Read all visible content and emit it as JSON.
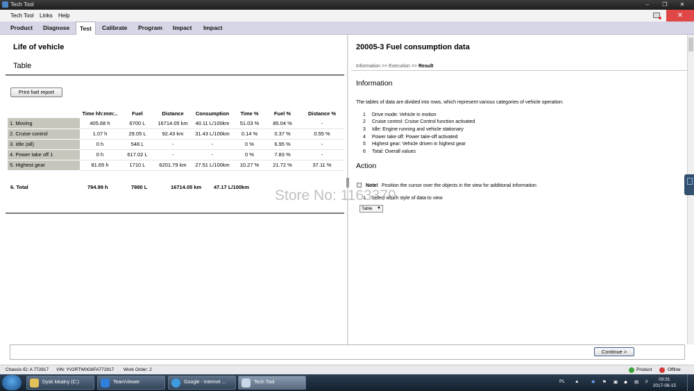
{
  "window": {
    "title": "Tech Tool"
  },
  "menu": {
    "items": [
      "Tech Tool",
      "Links",
      "Help"
    ]
  },
  "nav": {
    "tabs": [
      "Product",
      "Diagnose",
      "Test",
      "Calibrate",
      "Program",
      "Impact",
      "Impact"
    ],
    "active": "Test"
  },
  "left": {
    "title": "Life of vehicle",
    "subtitle": "Table",
    "print_button": "Print fuel report",
    "columns": [
      "Time hh:mm:..",
      "Fuel",
      "Distance",
      "Consumption",
      "Time %",
      "Fuel %",
      "Distance %"
    ],
    "rows": [
      {
        "label": "1. Moving",
        "cells": [
          "405.68 h",
          "6700 L",
          "16714.05 km",
          "40.11 L/100km",
          "51.03 %",
          "85.04 %",
          "-"
        ]
      },
      {
        "label": "2. Cruise control",
        "cells": [
          "1.07 h",
          "29.05 L",
          "92.43 km",
          "31.43 L/100km",
          "0.14 %",
          "0.37 %",
          "0.55 %"
        ]
      },
      {
        "label": "3. Idle (all)",
        "cells": [
          "0 h",
          "548 L",
          "-",
          "-",
          "0 %",
          "6.95 %",
          "-"
        ]
      },
      {
        "label": "4. Power take off 1",
        "cells": [
          "0 h",
          "617.02 L",
          "-",
          "-",
          "0 %",
          "7.83 %",
          "-"
        ]
      },
      {
        "label": "5. Highest gear",
        "cells": [
          "81.65 h",
          "1710 L",
          "6201.79 km",
          "27.51 L/100km",
          "10.27 %",
          "21.72 %",
          "37.11 %"
        ]
      }
    ],
    "total": {
      "label": "6. Total",
      "time": "794.99 h",
      "fuel": "7880 L",
      "distance": "16714.05 km",
      "consumption": "47.17 L/100km"
    }
  },
  "right": {
    "title": "20005-3 Fuel consumption data",
    "breadcrumb": {
      "step1": "Information",
      "sep1": ">>",
      "step2": "Execution",
      "sep2": ">>",
      "current": "Result"
    },
    "information_heading": "Information",
    "information_text": "The tables of data are divided into rows, which represent various categories of vehicle operation:",
    "list": [
      {
        "num": "1",
        "text": "Drive mode: Vehicle in motion"
      },
      {
        "num": "2",
        "text": "Cruise control: Cruise Control function activated"
      },
      {
        "num": "3",
        "text": "Idle: Engine running and vehicle stationary"
      },
      {
        "num": "4",
        "text": "Power take off: Power take-off activated"
      },
      {
        "num": "5",
        "text": "Highest gear: Vehicle driven in highest gear"
      },
      {
        "num": "6",
        "text": "Total: Overall values"
      }
    ],
    "action_heading": "Action",
    "note_label": "Note!",
    "note_text": "Position the cursor over the objects in the view for additional information",
    "step_num": "1",
    "step_text": "Select which style of data to view",
    "select_value": "Table"
  },
  "footer": {
    "continue_button": "Continue >"
  },
  "status": {
    "chassis": "Chassis ID: A 772817",
    "vin": "VIN: YV2RTW0G6FA772817",
    "work_order": "Work Order: 2",
    "product": "Product",
    "offline": "Offline"
  },
  "taskbar": {
    "tasks": [
      "Dysk lokalny (C:)",
      "TeamViewer",
      "Google - Internet ...",
      "Tech Tool"
    ],
    "lang": "PL",
    "time": "03:31",
    "date": "2017-08-15"
  },
  "watermark": "Store No: 1163370",
  "colors": {
    "close": "#e04848",
    "nav_bg": "#d6d6e6",
    "row_label_bg": "#c6c6bc",
    "taskbar": "#1d2b3a"
  }
}
